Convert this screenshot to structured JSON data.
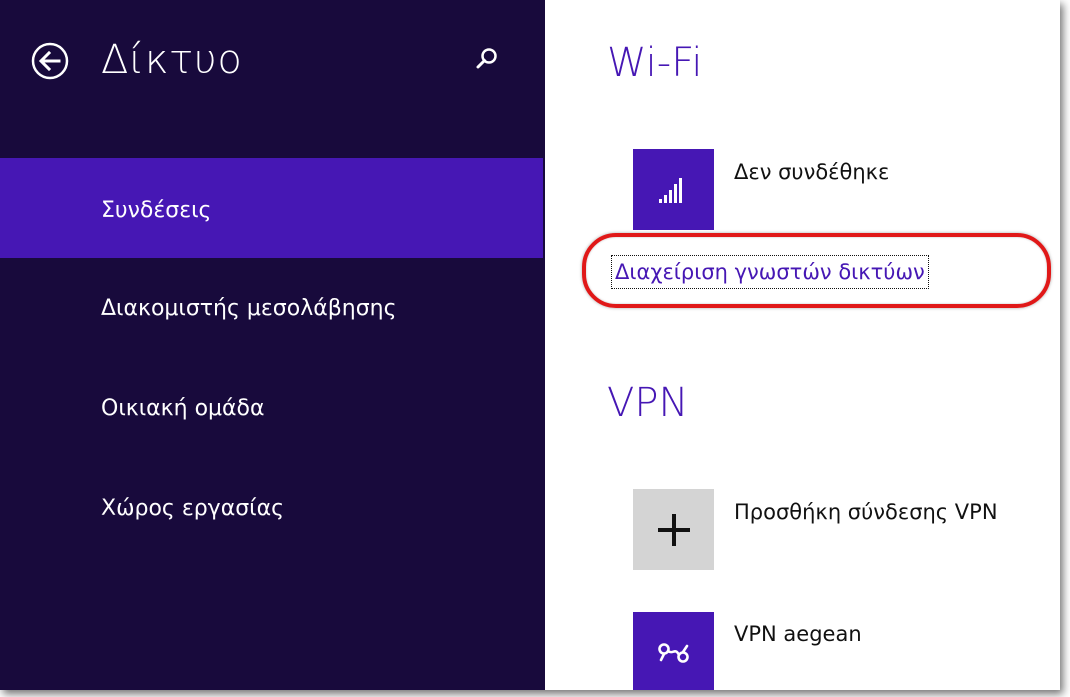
{
  "sidebar": {
    "title": "Δίκτυο",
    "back_icon": "back-arrow-icon",
    "search_icon": "search-icon",
    "items": [
      {
        "label": "Συνδέσεις",
        "selected": true
      },
      {
        "label": "Διακομιστής μεσολάβησης",
        "selected": false
      },
      {
        "label": "Οικιακή ομάδα",
        "selected": false
      },
      {
        "label": "Χώρος εργασίας",
        "selected": false
      }
    ]
  },
  "main": {
    "wifi": {
      "title": "Wi-Fi",
      "status_icon": "wifi-signal-icon",
      "status": "Δεν συνδέθηκε",
      "manage_link": "Διαχείριση γνωστών δικτύων"
    },
    "vpn": {
      "title": "VPN",
      "add_icon": "plus-icon",
      "add_label": "Προσθήκη σύνδεσης VPN",
      "connection_icon": "vpn-icon",
      "connection_label": "VPN aegean"
    }
  },
  "colors": {
    "sidebar_bg": "#180a3c",
    "accent": "#4617b4",
    "highlight": "#e01818",
    "tile_gray": "#d4d4d4"
  }
}
